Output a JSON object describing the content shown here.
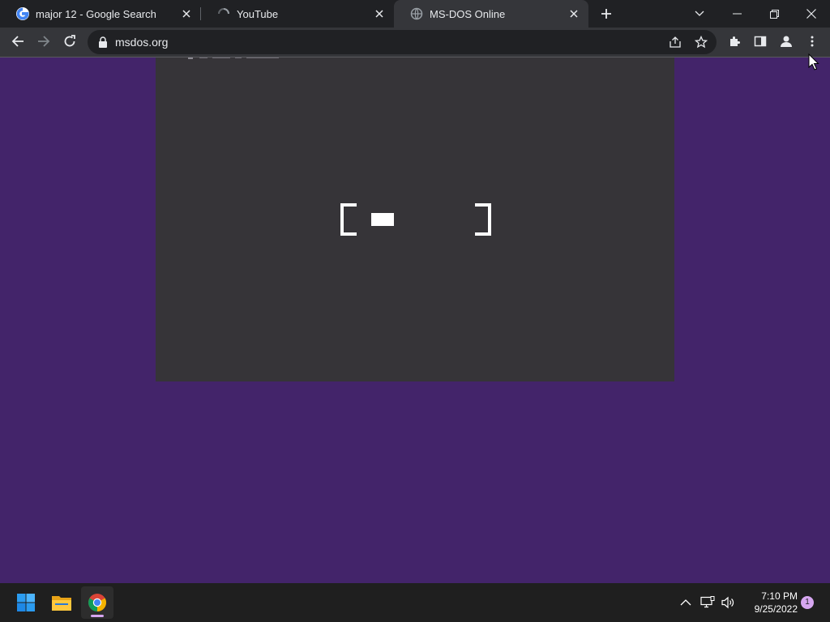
{
  "browser": {
    "tabs": [
      {
        "title": "major 12 - Google Search",
        "favicon": "google-icon",
        "active": false
      },
      {
        "title": "YouTube",
        "favicon": "loading-spinner-icon",
        "active": false
      },
      {
        "title": "MS-DOS Online",
        "favicon": "globe-icon",
        "active": true
      }
    ],
    "url": "msdos.org"
  },
  "page": {
    "background_color": "#43246a",
    "dos_screen_color": "#363438",
    "loader": {
      "progress": 0.25
    }
  },
  "taskbar": {
    "apps": [
      "windows-start-icon",
      "file-explorer-icon",
      "chrome-icon"
    ],
    "clock": {
      "time": "7:10 PM",
      "date": "9/25/2022"
    },
    "notification_count": "1"
  }
}
